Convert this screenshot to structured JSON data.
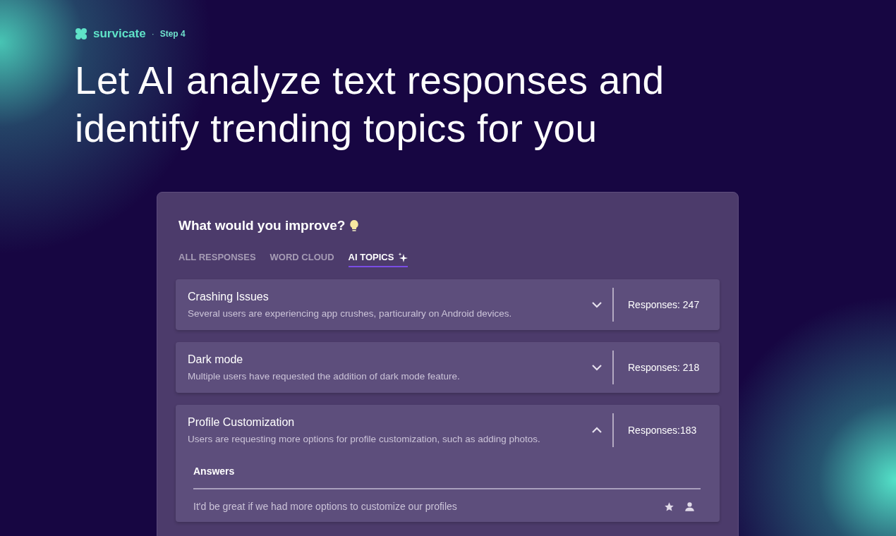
{
  "brand": {
    "name": "survicate",
    "separator": "·",
    "step": "Step 4"
  },
  "headline": "Let AI analyze text responses and identify trending topics for you",
  "card": {
    "question": "What would you improve?",
    "tabs": [
      {
        "label": "ALL RESPONSES",
        "selected": false
      },
      {
        "label": "WORD CLOUD",
        "selected": false
      },
      {
        "label": "AI TOPICS",
        "selected": true
      }
    ],
    "topics": [
      {
        "title": "Crashing Issues",
        "summary": "Several users are experiencing app crushes, particuralry on Android devices.",
        "responses": "Responses: 247",
        "expanded": false
      },
      {
        "title": "Dark mode",
        "summary": "Multiple users have requested the addition of dark mode feature.",
        "responses": "Responses: 218",
        "expanded": false
      },
      {
        "title": "Profile Customization",
        "summary": "Users are requesting more options for profile customization, such as adding photos.",
        "responses": "Responses:183",
        "expanded": true,
        "answers_title": "Answers",
        "answers": [
          "It'd be great if we had more options to customize our profiles"
        ]
      }
    ]
  }
}
